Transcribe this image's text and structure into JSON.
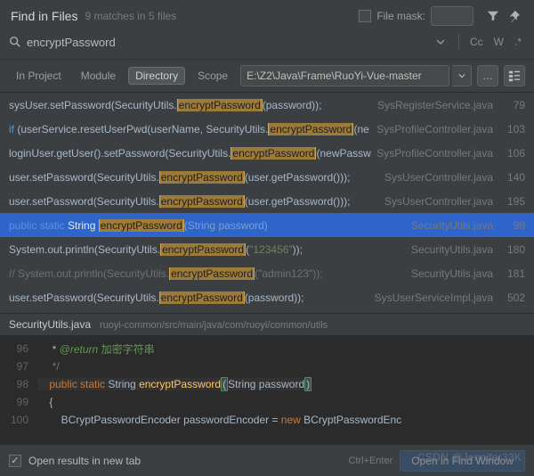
{
  "header": {
    "title": "Find in Files",
    "subtitle": "9 matches in 5 files",
    "file_mask_label": "File mask:"
  },
  "search": {
    "query": "encryptPassword",
    "toggles": {
      "case": "Cc",
      "word": "W",
      "regex": ".*"
    }
  },
  "scope_tabs": {
    "in_project": "In Project",
    "module": "Module",
    "directory": "Directory",
    "scope": "Scope"
  },
  "directory_path": "E:\\Z2\\Java\\Frame\\RuoYi-Vue-master",
  "results": [
    {
      "pre": "sysUser.setPassword(SecurityUtils.",
      "match": "encryptPassword",
      "post_a": "(password));",
      "file": "SysRegisterService.java",
      "line": "79"
    },
    {
      "pre_kw": "if",
      "pre": " (userService.resetUserPwd(userName, SecurityUtils.",
      "match": "encryptPassword",
      "post_a": "(ne",
      "file": "SysProfileController.java",
      "line": "103"
    },
    {
      "pre": "loginUser.getUser().setPassword(SecurityUtils.",
      "match": "encryptPassword",
      "post_a": "(newPassw",
      "file": "SysProfileController.java",
      "line": "106"
    },
    {
      "pre": "user.setPassword(SecurityUtils.",
      "match": "encryptPassword",
      "post_a": "(user.getPassword()));",
      "file": "SysUserController.java",
      "line": "140"
    },
    {
      "pre": "user.setPassword(SecurityUtils.",
      "match": "encryptPassword",
      "post_a": "(user.getPassword()));",
      "file": "SysUserController.java",
      "line": "195"
    },
    {
      "selected": true,
      "pre_kw": "public static",
      "pre_ty": " String ",
      "match": "encryptPassword",
      "post_a": "(String password)",
      "file": "SecurityUtils.java",
      "line": "98"
    },
    {
      "pre": "System.out.println(SecurityUtils.",
      "match": "encryptPassword",
      "post_str": "\"123456\"",
      "post_b": "));",
      "post_a": "(",
      "file": "SecurityUtils.java",
      "line": "180"
    },
    {
      "comment": true,
      "pre": "//        System.out.println(SecurityUtils.",
      "match": "encryptPassword",
      "post_a": "(\"admin123\"));",
      "file": "SecurityUtils.java",
      "line": "181"
    },
    {
      "pre": "user.setPassword(SecurityUtils.",
      "match": "encryptPassword",
      "post_a": "(password));",
      "file": "SysUserServiceImpl.java",
      "line": "502"
    }
  ],
  "preview": {
    "file": "SecurityUtils.java",
    "path": "ruoyi-common/src/main/java/com/ruoyi/common/utils",
    "lines": [
      {
        "n": "96",
        "html": "     * <span class='tag-green'>@return</span> <span class='cjk'>加密字符串</span>"
      },
      {
        "n": "97",
        "html": "     <span class='comment'>*/</span>"
      },
      {
        "n": "98",
        "hl": true,
        "html": "    <span class='kw-orange'>public static</span> String <span class='fn-yellow'>encryptPassword</span><span class='paren-hl'>(</span>String password<span class='paren-hl'>)</span>"
      },
      {
        "n": "99",
        "html": "    {"
      },
      {
        "n": "100",
        "html": "        BCryptPasswordEncoder passwordEncoder = <span class='kw-orange'>new</span> BCryptPasswordEnc"
      }
    ]
  },
  "footer": {
    "open_new_tab": "Open results in new tab",
    "hint": "Ctrl+Enter",
    "button": "Open in Find Window"
  },
  "watermark": "CSDN @Jennifer33K"
}
